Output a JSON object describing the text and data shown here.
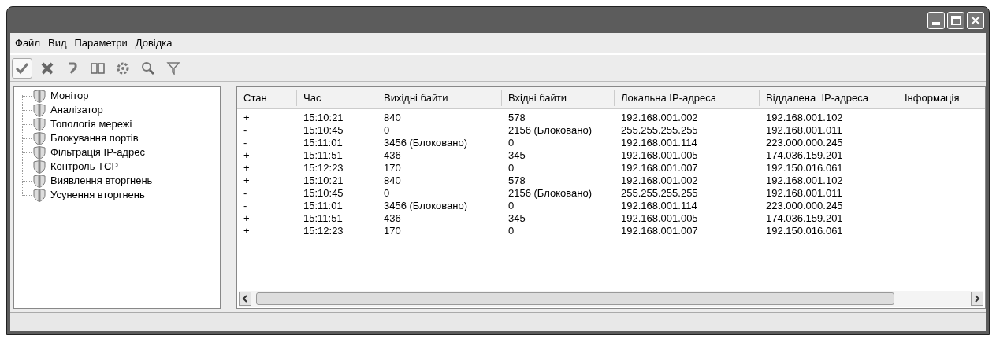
{
  "menu": [
    "Файл",
    "Вид",
    "Параметри",
    "Довідка"
  ],
  "toolbar": [
    {
      "kind": "check",
      "pressed": true
    },
    {
      "kind": "cross",
      "pressed": false
    },
    {
      "kind": "undo",
      "pressed": false
    },
    {
      "kind": "book",
      "pressed": false
    },
    {
      "kind": "gear",
      "pressed": false
    },
    {
      "kind": "search",
      "pressed": false
    },
    {
      "kind": "filter",
      "pressed": false
    }
  ],
  "tree": [
    "Монітор",
    "Аналізатор",
    "Топологія мережі",
    "Блокування портів",
    "Фільтрація IP-адрес",
    "Контроль TCP",
    "Виявлення вторгнень",
    "Усунення вторгнень"
  ],
  "table": {
    "columns": [
      "Стан",
      "Час",
      "Вихідні байти",
      "Вхідні байти",
      "Локальна IP-адреса",
      "Віддалена  IP-адреса",
      "Інформація"
    ],
    "rows": [
      [
        "+",
        "15:10:21",
        "840",
        "578",
        "192.168.001.002",
        "192.168.001.102"
      ],
      [
        "-",
        "15:10:45",
        "0",
        "2156 (Блоковано)",
        "255.255.255.255",
        "192.168.001.011"
      ],
      [
        "-",
        "15:11:01",
        "3456 (Блоковано)",
        "0",
        "192.168.001.114",
        "223.000.000.245"
      ],
      [
        "+",
        "15:11:51",
        "436",
        "345",
        "192.168.001.005",
        "174.036.159.201"
      ],
      [
        "+",
        "15:12:23",
        "170",
        "0",
        "192.168.001.007",
        "192.150.016.061"
      ],
      [
        "+",
        "15:10:21",
        "840",
        "578",
        "192.168.001.002",
        "192.168.001.102"
      ],
      [
        "-",
        "15:10:45",
        "0",
        "2156 (Блоковано)",
        "255.255.255.255",
        "192.168.001.011"
      ],
      [
        "-",
        "15:11:01",
        "3456 (Блоковано)",
        "0",
        "192.168.001.114",
        "223.000.000.245"
      ],
      [
        "+",
        "15:11:51",
        "436",
        "345",
        "192.168.001.005",
        "174.036.159.201"
      ],
      [
        "+",
        "15:12:23",
        "170",
        "0",
        "192.168.001.007",
        "192.150.016.061"
      ]
    ]
  }
}
